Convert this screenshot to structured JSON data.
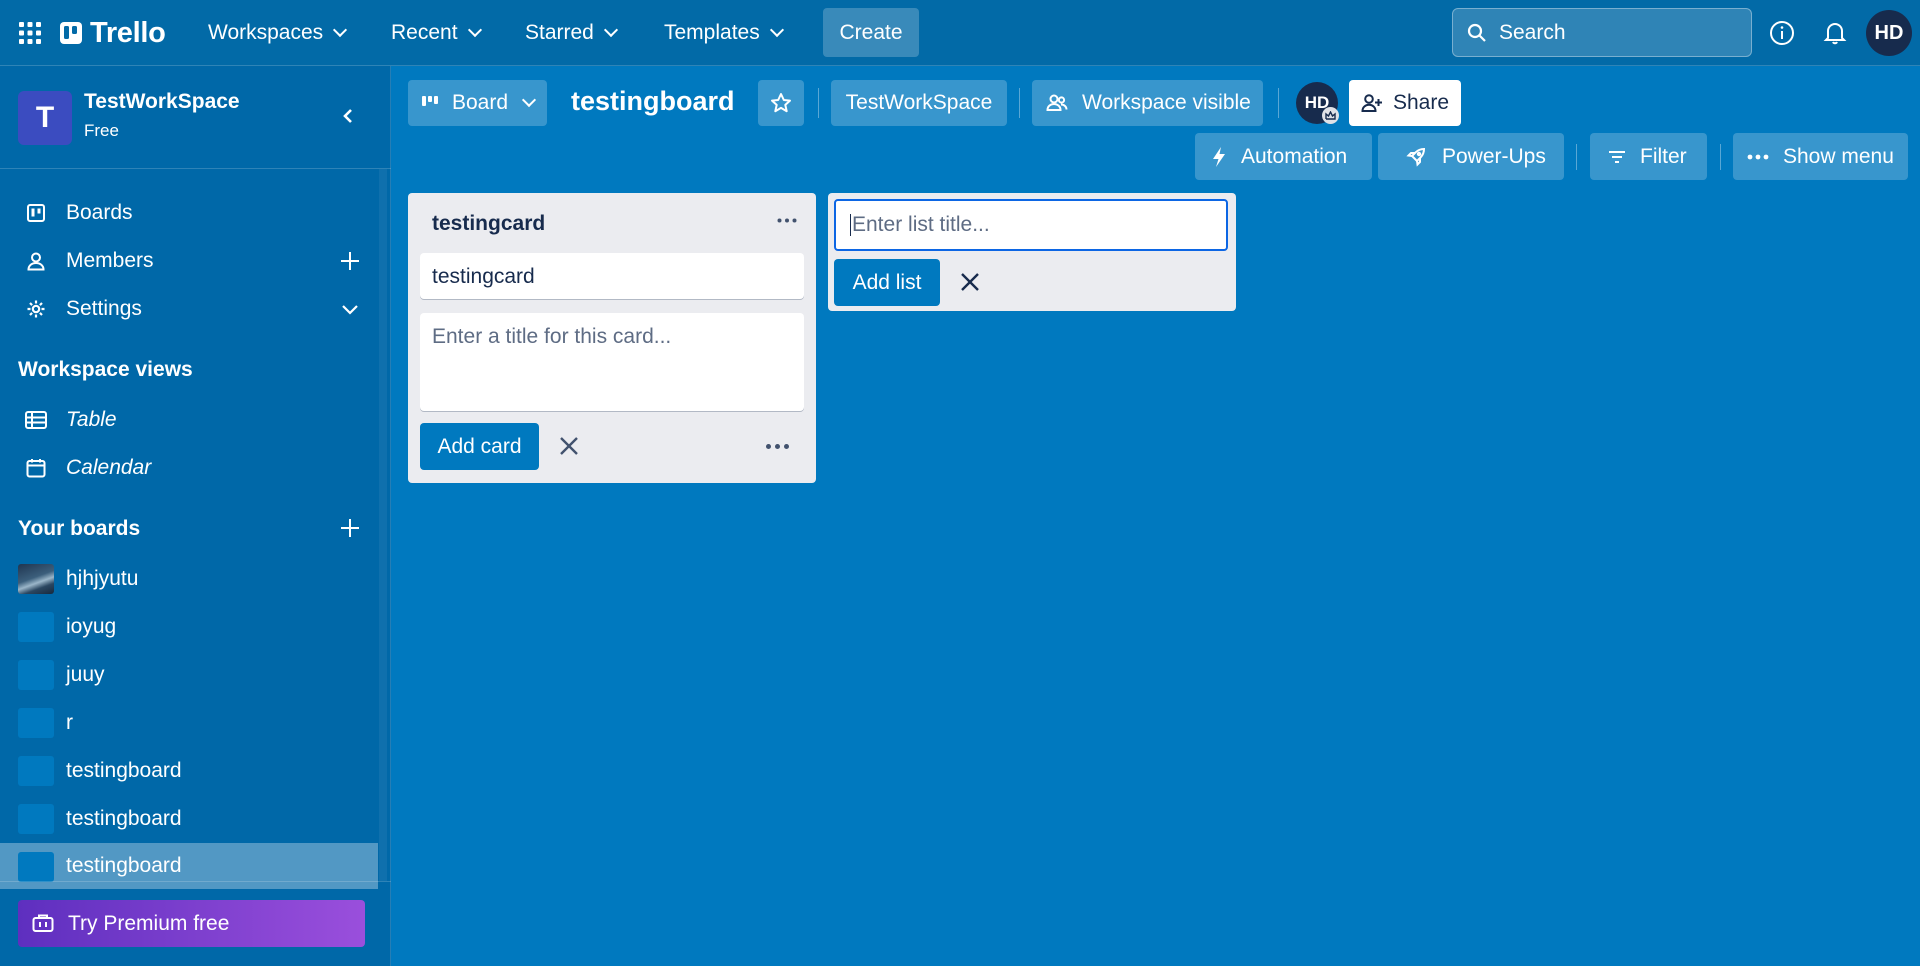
{
  "header": {
    "brand": "Trello",
    "nav": [
      {
        "label": "Workspaces"
      },
      {
        "label": "Recent"
      },
      {
        "label": "Starred"
      },
      {
        "label": "Templates"
      }
    ],
    "create_label": "Create",
    "search_placeholder": "Search",
    "avatar_initials": "HD"
  },
  "sidebar": {
    "workspace_initial": "T",
    "workspace_name": "TestWorkSpace",
    "workspace_plan": "Free",
    "items": [
      {
        "label": "Boards",
        "icon": "board-icon"
      },
      {
        "label": "Members",
        "icon": "person-icon"
      },
      {
        "label": "Settings",
        "icon": "gear-icon"
      }
    ],
    "views_title": "Workspace views",
    "views": [
      {
        "label": "Table",
        "icon": "table-icon"
      },
      {
        "label": "Calendar",
        "icon": "calendar-icon"
      }
    ],
    "boards_title": "Your boards",
    "boards": [
      {
        "label": "hjhjyutu"
      },
      {
        "label": "ioyug"
      },
      {
        "label": "juuy"
      },
      {
        "label": "r"
      },
      {
        "label": "testingboard"
      },
      {
        "label": "testingboard"
      },
      {
        "label": "testingboard"
      }
    ],
    "premium_label": "Try Premium free"
  },
  "board": {
    "view_label": "Board",
    "title": "testingboard",
    "workspace_label": "TestWorkSpace",
    "visibility_label": "Workspace visible",
    "member_initials": "HD",
    "share_label": "Share",
    "automation_label": "Automation",
    "powerups_label": "Power-Ups",
    "filter_label": "Filter",
    "show_menu_label": "Show menu"
  },
  "lists": [
    {
      "title": "testingcard",
      "cards": [
        {
          "title": "testingcard"
        }
      ],
      "composer_placeholder": "Enter a title for this card...",
      "add_card_label": "Add card"
    }
  ],
  "add_list": {
    "placeholder": "Enter list title...",
    "add_label": "Add list"
  },
  "colors": {
    "board_bg": "#0079bf",
    "header_bg": "#026aa7",
    "sidebar_bg": "#0068a8",
    "list_bg": "#ebecf0",
    "primary_button": "#0079bf",
    "premium_gradient_start": "#5e2fbf",
    "premium_gradient_end": "#9a4fdc"
  }
}
